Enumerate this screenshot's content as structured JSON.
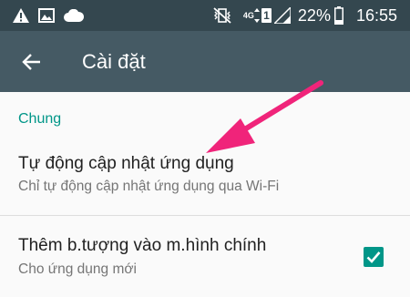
{
  "status_bar": {
    "notification_icons": [
      "warning-icon",
      "image-icon",
      "cloud-icon"
    ],
    "mute_icon": "vibrate-mute-icon",
    "network_label": "4G",
    "sim_label": "1",
    "battery_percent": "22%",
    "time": "16:55"
  },
  "app_bar": {
    "back_icon": "arrow-back-icon",
    "title": "Cài đặt"
  },
  "section": {
    "header": "Chung"
  },
  "settings": [
    {
      "title": "Tự động cập nhật ứng dụng",
      "subtitle": "Chỉ tự động cập nhật ứng dụng qua Wi-Fi"
    },
    {
      "title": "Thêm b.tượng vào m.hình chính",
      "subtitle": "Cho ứng dụng mới",
      "checked": true
    }
  ],
  "colors": {
    "status_bar": "#34474f",
    "app_bar": "#455a64",
    "accent": "#009688",
    "annotation_arrow": "#f0247a"
  }
}
